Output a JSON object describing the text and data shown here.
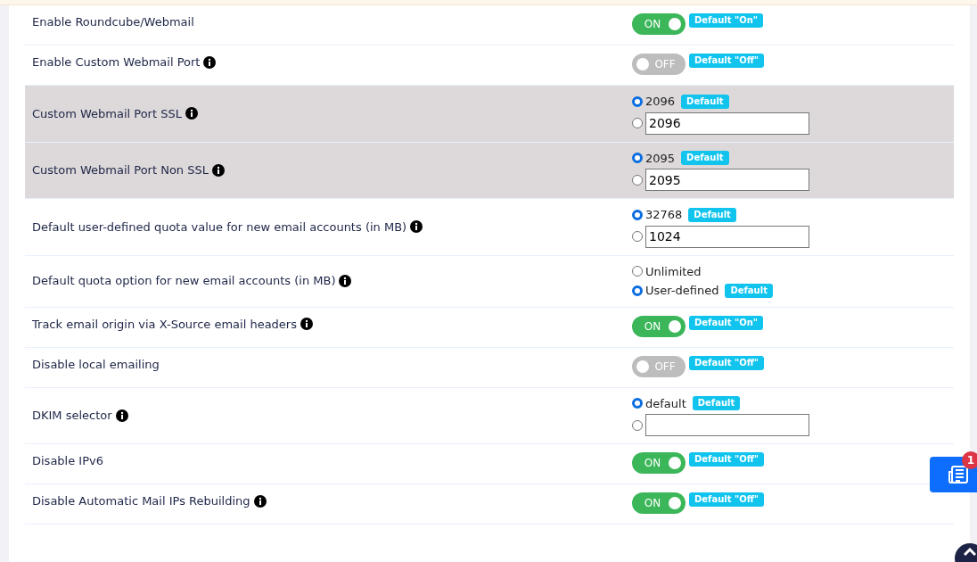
{
  "rows": [
    {
      "label": "Enable Roundcube/Webmail",
      "info": false,
      "highlighted": false,
      "kind": "toggle",
      "on": true,
      "toggle_text": "ON",
      "badge": "Default \"On\""
    },
    {
      "label": "Enable Custom Webmail Port",
      "info": true,
      "highlighted": false,
      "kind": "toggle",
      "on": false,
      "toggle_text": "OFF",
      "badge": "Default \"Off\""
    },
    {
      "label": "Custom Webmail Port SSL",
      "info": true,
      "highlighted": true,
      "kind": "radio",
      "options": [
        {
          "kind": "choice",
          "label": "2096",
          "selected": true,
          "badge": "Default"
        },
        {
          "kind": "input",
          "value": "2096",
          "selected": false
        }
      ]
    },
    {
      "label": "Custom Webmail Port Non SSL",
      "info": true,
      "highlighted": true,
      "kind": "radio",
      "options": [
        {
          "kind": "choice",
          "label": "2095",
          "selected": true,
          "badge": "Default"
        },
        {
          "kind": "input",
          "value": "2095",
          "selected": false
        }
      ]
    },
    {
      "label": "Default user-defined quota value for new email accounts (in MB)",
      "info": true,
      "highlighted": false,
      "kind": "radio",
      "options": [
        {
          "kind": "choice",
          "label": "32768",
          "selected": true,
          "badge": "Default"
        },
        {
          "kind": "input",
          "value": "1024",
          "selected": false
        }
      ]
    },
    {
      "label": "Default quota option for new email accounts (in MB)",
      "info": true,
      "highlighted": false,
      "kind": "radio",
      "options": [
        {
          "kind": "choice",
          "label": "Unlimited",
          "selected": false
        },
        {
          "kind": "choice",
          "label": "User-defined",
          "selected": true,
          "badge": "Default"
        }
      ]
    },
    {
      "label": "Track email origin via X-Source email headers",
      "info": true,
      "highlighted": false,
      "kind": "toggle",
      "on": true,
      "toggle_text": "ON",
      "badge": "Default \"On\""
    },
    {
      "label": "Disable local emailing",
      "info": false,
      "highlighted": false,
      "kind": "toggle",
      "on": false,
      "toggle_text": "OFF",
      "badge": "Default \"Off\""
    },
    {
      "label": "DKIM selector",
      "info": true,
      "highlighted": false,
      "kind": "radio",
      "options": [
        {
          "kind": "choice",
          "label": "default",
          "selected": true,
          "badge": "Default"
        },
        {
          "kind": "input",
          "selected": false
        }
      ]
    },
    {
      "label": "Disable IPv6",
      "info": false,
      "highlighted": false,
      "kind": "toggle",
      "on": true,
      "toggle_text": "ON",
      "badge": "Default \"Off\""
    },
    {
      "label": "Disable Automatic Mail IPs Rebuilding",
      "info": true,
      "highlighted": false,
      "kind": "toggle",
      "on": true,
      "toggle_text": "ON",
      "badge": "Default \"Off\""
    }
  ],
  "notification_count": "1"
}
